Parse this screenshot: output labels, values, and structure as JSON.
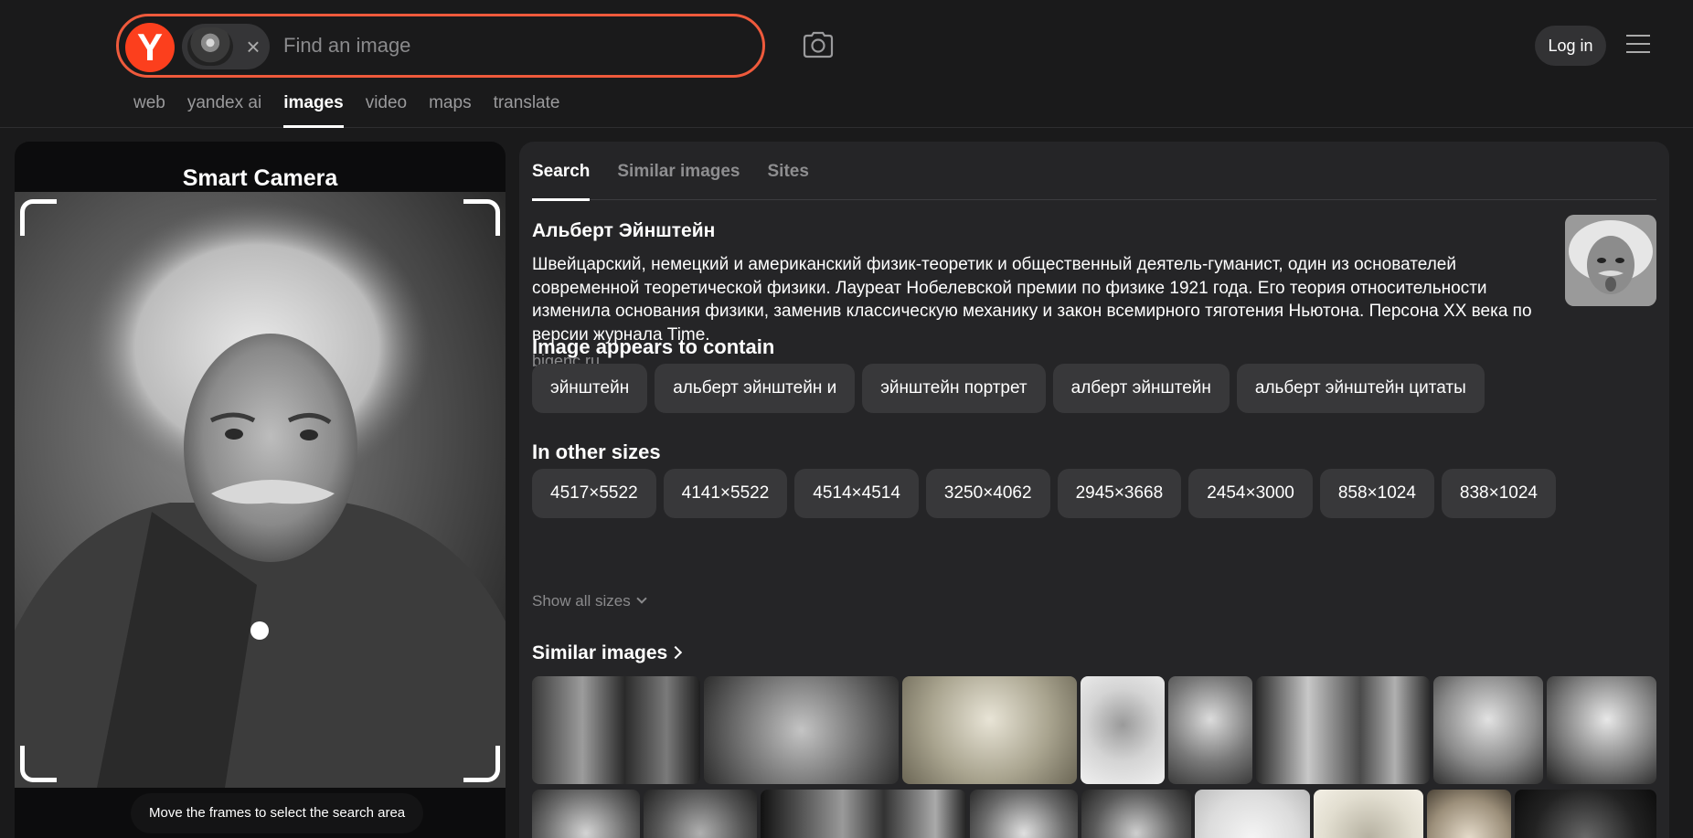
{
  "header": {
    "logo_letter": "Y",
    "search_placeholder": "Find an image",
    "login_label": "Log in"
  },
  "nav": [
    "web",
    "yandex ai",
    "images",
    "video",
    "maps",
    "translate"
  ],
  "nav_active": "images",
  "left_panel": {
    "title": "Smart Camera",
    "hint": "Move the frames to select the search area"
  },
  "tabs": [
    "Search",
    "Similar images",
    "Sites"
  ],
  "entity": {
    "title": "Альберт Эйнштейн",
    "description": "Швейцарский, немецкий и американский физик-теоретик и общественный деятель-гуманист, один из основателей современной теоретической физики. Лауреат Нобелевской премии по физике 1921 года. Его теория относительности изменила основания физики, заменив классическую механику и закон всемирного тяготения Ньютона. Персона XX века по версии журнала Time.",
    "source": "bigenc.ru"
  },
  "contains": {
    "title": "Image appears to contain",
    "tags": [
      "эйнштейн",
      "альберт эйнштейн и",
      "эйнштейн портрет",
      "алберт эйнштейн",
      "альберт эйнштейн цитаты"
    ]
  },
  "sizes": {
    "title": "In other sizes",
    "items": [
      "4517×5522",
      "4141×5522",
      "4514×4514",
      "3250×4062",
      "2945×3668",
      "2454×3000",
      "858×1024",
      "838×1024"
    ],
    "show_all": "Show all sizes"
  },
  "similar": {
    "title": "Similar images"
  },
  "colors": {
    "accent": "#fc3f1d",
    "search_border": "#ef5a3c",
    "panel_bg": "#252527",
    "chip_bg": "#38383a"
  }
}
